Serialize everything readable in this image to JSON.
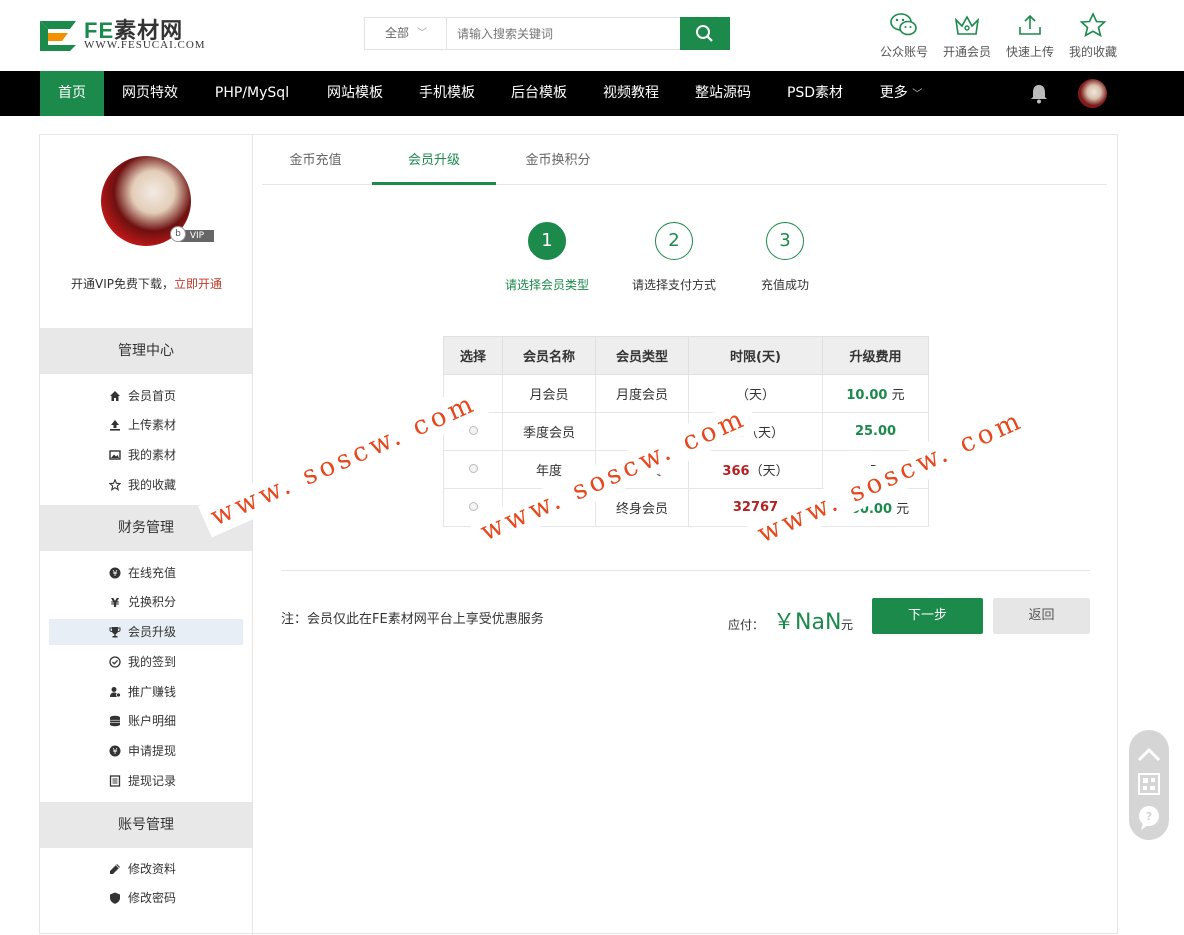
{
  "header": {
    "logo_text_fe": "FE",
    "logo_text_rest": "素材网",
    "logo_sub": "WWW.FESUCAI.COM",
    "search_category": "全部",
    "search_placeholder": "请输入搜索关键词",
    "icons": [
      {
        "icon": "wechat-icon",
        "label": "公众账号"
      },
      {
        "icon": "crown-icon",
        "label": "开通会员"
      },
      {
        "icon": "upload-icon",
        "label": "快速上传"
      },
      {
        "icon": "star-icon",
        "label": "我的收藏"
      }
    ]
  },
  "nav": {
    "items": [
      "首页",
      "网页特效",
      "PHP/MySql",
      "网站模板",
      "手机模板",
      "后台模板",
      "视频教程",
      "整站源码",
      "PSD素材",
      "更多"
    ]
  },
  "sidebar": {
    "vip_badge_b": "b",
    "vip_badge_text": "VIP",
    "vip_prompt": "开通VIP免费下载，",
    "vip_link": "立即开通",
    "sections": [
      {
        "title": "管理中心",
        "items": [
          {
            "icon": "home-icon",
            "label": "会员首页"
          },
          {
            "icon": "upload-icon",
            "label": "上传素材"
          },
          {
            "icon": "image-icon",
            "label": "我的素材"
          },
          {
            "icon": "star-icon",
            "label": "我的收藏"
          }
        ]
      },
      {
        "title": "财务管理",
        "items": [
          {
            "icon": "yen-icon",
            "label": "在线充值"
          },
          {
            "icon": "exchange-icon",
            "label": "兑换积分"
          },
          {
            "icon": "trophy-icon",
            "label": "会员升级"
          },
          {
            "icon": "check-circle-icon",
            "label": "我的签到"
          },
          {
            "icon": "user-promote-icon",
            "label": "推广赚钱"
          },
          {
            "icon": "database-icon",
            "label": "账户明细"
          },
          {
            "icon": "yen-icon",
            "label": "申请提现"
          },
          {
            "icon": "list-icon",
            "label": "提现记录"
          }
        ]
      },
      {
        "title": "账号管理",
        "items": [
          {
            "icon": "edit-icon",
            "label": "修改资料"
          },
          {
            "icon": "shield-icon",
            "label": "修改密码"
          }
        ]
      }
    ]
  },
  "tabs": [
    "金币充值",
    "会员升级",
    "金币换积分"
  ],
  "steps": [
    {
      "num": "1",
      "label": "请选择会员类型"
    },
    {
      "num": "2",
      "label": "请选择支付方式"
    },
    {
      "num": "3",
      "label": "充值成功"
    }
  ],
  "table": {
    "headers": [
      "选择",
      "会员名称",
      "会员类型",
      "时限(天)",
      "升级费用"
    ],
    "rows": [
      {
        "name": "月会员",
        "type": "月度会员",
        "days": "",
        "days_unit": "（天）",
        "price": "10.00",
        "price_unit": "元"
      },
      {
        "name": "季度会员",
        "type": "",
        "days": "90",
        "days_unit": "（天）",
        "price": "25.00",
        "price_unit": ""
      },
      {
        "name": "年度",
        "type": "度会员",
        "days": "366",
        "days_unit": "（天）",
        "price": "",
        "price_unit": "元"
      },
      {
        "name": "员",
        "type": "终身会员",
        "days": "32767",
        "days_unit": "",
        "price": "300.00",
        "price_unit": "元"
      }
    ]
  },
  "footer": {
    "note": "注：会员仅此在FE素材网平台上享受优惠服务",
    "pay_label": "应付：",
    "pay_amount": "￥NaN",
    "pay_unit": "元",
    "next_label": "下一步",
    "back_label": "返回"
  },
  "watermark": "www. soscw. com",
  "colors": {
    "brand": "#1b8a4b",
    "days": "#b22222",
    "link": "#c0392b",
    "watermark": "#e8471c"
  }
}
